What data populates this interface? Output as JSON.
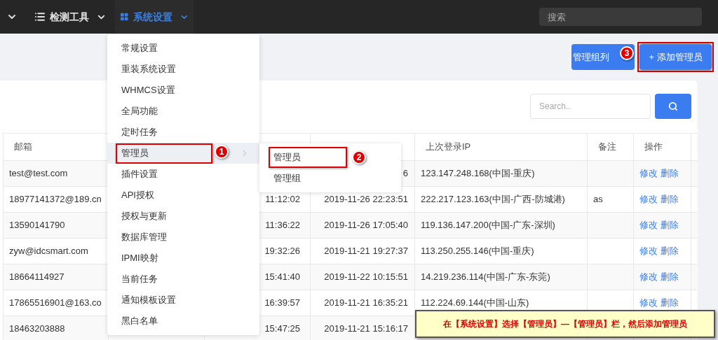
{
  "nav": {
    "items": [
      {
        "label": "检测工具",
        "selected": false
      },
      {
        "label": "系统设置",
        "selected": true
      }
    ],
    "search": {
      "placeholder": "搜索"
    }
  },
  "toolbar": {
    "buttons": [
      {
        "label": "管理组列",
        "highlighted": false
      },
      {
        "label": "+ 添加管理员",
        "highlighted": true,
        "badge": "3"
      }
    ]
  },
  "table_search": {
    "placeholder": "Search.."
  },
  "table": {
    "columns": {
      "email": "邮箱",
      "last_login_ip": "上次登录IP",
      "note": "备注",
      "actions": "操作"
    },
    "rows": [
      {
        "email": "test@test.com",
        "column_4": "6",
        "last_login_ip": "123.147.248.168(中国-重庆)",
        "actions": [
          "修改",
          "删除"
        ]
      },
      {
        "email": "18977141372@189.cn",
        "column_3": "11:12:02",
        "column_4": "2019-11-26 22:23:51",
        "last_login_ip": "222.217.123.163(中国-广西-防城港)",
        "note": "as",
        "actions": [
          "修改",
          "删除"
        ]
      },
      {
        "email": "13590141790",
        "column_3": "11:36:22",
        "column_4": "2019-11-26 17:05:40",
        "last_login_ip": "119.136.147.200(中国-广东-深圳)",
        "actions": [
          "修改",
          "删除"
        ]
      },
      {
        "email": "zyw@idcsmart.com",
        "column_3": "19:32:26",
        "column_4": "2019-11-21 19:27:37",
        "last_login_ip": "113.250.255.146(中国-重庆)",
        "actions": [
          "修改",
          "删除"
        ]
      },
      {
        "email": "18664114927",
        "column_3": "15:41:40",
        "column_4": "2019-11-22 10:15:51",
        "last_login_ip": "14.219.236.114(中国-广东-东莞)",
        "actions": [
          "修改",
          "删除"
        ]
      },
      {
        "email": "17865516901@163.co",
        "column_3": "16:39:57",
        "column_4": "2019-11-21 16:35:21",
        "last_login_ip": "112.224.69.144(中国-山东)",
        "actions": [
          "修改",
          "删除"
        ]
      },
      {
        "email": "18463203888",
        "column_3": "15:47:25",
        "column_4": "2019-11-21 15:16:17"
      }
    ]
  },
  "menu": {
    "items": [
      {
        "label": "常规设置",
        "selected": false
      },
      {
        "label": "重装系统设置",
        "selected": false
      },
      {
        "label": "WHMCS设置",
        "selected": false
      },
      {
        "label": "全局功能",
        "selected": false
      },
      {
        "label": "定时任务",
        "selected": false
      },
      {
        "label": "管理员",
        "selected": true,
        "highlighted": true,
        "badge": "1",
        "has_submenu": true
      },
      {
        "label": "插件设置",
        "selected": false
      },
      {
        "label": "API授权",
        "selected": false
      },
      {
        "label": "授权与更新",
        "selected": false
      },
      {
        "label": "数据库管理",
        "selected": false
      },
      {
        "label": "IPMI映射",
        "selected": false
      },
      {
        "label": "当前任务",
        "selected": false
      },
      {
        "label": "通知模板设置",
        "selected": false
      },
      {
        "label": "黑白名单",
        "selected": false
      }
    ]
  },
  "submenu": {
    "items": [
      {
        "label": "管理员",
        "highlighted": true,
        "badge": "2"
      },
      {
        "label": "管理组",
        "highlighted": false
      }
    ]
  },
  "note": "在【系统设置】选择【管理员】—【管理员】栏，然后添加管理员"
}
